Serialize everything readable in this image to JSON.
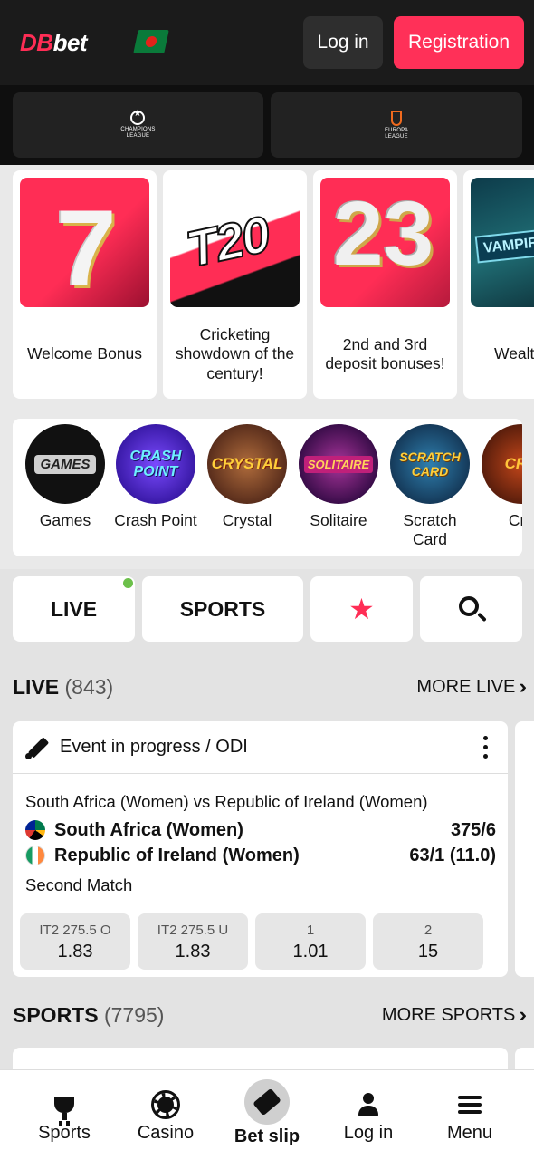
{
  "header": {
    "logo_db": "DB",
    "logo_bet": "bet",
    "login_label": "Log in",
    "register_label": "Registration"
  },
  "leagues": [
    {
      "line1": "CHAMPIONS",
      "line2": "LEAGUE"
    },
    {
      "line1": "EUROPA",
      "line2": "LEAGUE"
    }
  ],
  "promos": [
    {
      "art": "7",
      "title": "Welcome Bonus"
    },
    {
      "art": "T20",
      "title": "Cricketing showdown of the century!"
    },
    {
      "art": "23",
      "title": "2nd and 3rd deposit bonuses!"
    },
    {
      "art": "VAMPIRE",
      "title": "Wealt eterna"
    }
  ],
  "games": [
    {
      "art": "GAMES",
      "label": "Games"
    },
    {
      "art": "CRASH POINT",
      "label": "Crash Point"
    },
    {
      "art": "CRYSTAL",
      "label": "Crystal"
    },
    {
      "art": "SOLITAIRE",
      "label": "Solitaire"
    },
    {
      "art": "SCRATCH CARD",
      "label": "Scratch Card"
    },
    {
      "art": "CRA",
      "label": "Cra"
    }
  ],
  "tabs": {
    "live": "LIVE",
    "sports": "SPORTS"
  },
  "live_section": {
    "title": "LIVE",
    "count": "(843)",
    "more": "MORE LIVE"
  },
  "event": {
    "status": "Event in progress / ODI",
    "match": "South Africa (Women) vs Republic of Ireland (Women)",
    "team1": {
      "name": "South Africa (Women)",
      "score": "375/6"
    },
    "team2": {
      "name": "Republic of Ireland (Women)",
      "score": "63/1 (11.0)"
    },
    "note": "Second Match",
    "odds": [
      {
        "label": "IT2 275.5 O",
        "value": "1.83"
      },
      {
        "label": "IT2 275.5 U",
        "value": "1.83"
      },
      {
        "label": "1",
        "value": "1.01"
      },
      {
        "label": "2",
        "value": "15"
      }
    ]
  },
  "sports_section": {
    "title": "SPORTS",
    "count": "(7795)",
    "more": "MORE SPORTS"
  },
  "bottom_nav": [
    {
      "icon": "trophy-icon",
      "label": "Sports"
    },
    {
      "icon": "chip-icon",
      "label": "Casino"
    },
    {
      "icon": "ticket-icon",
      "label": "Bet slip"
    },
    {
      "icon": "user-icon",
      "label": "Log in"
    },
    {
      "icon": "menu-icon",
      "label": "Menu"
    }
  ],
  "colors": {
    "accent": "#ff3058",
    "header_bg": "#1b1b1b",
    "live_dot": "#6cc04a"
  }
}
